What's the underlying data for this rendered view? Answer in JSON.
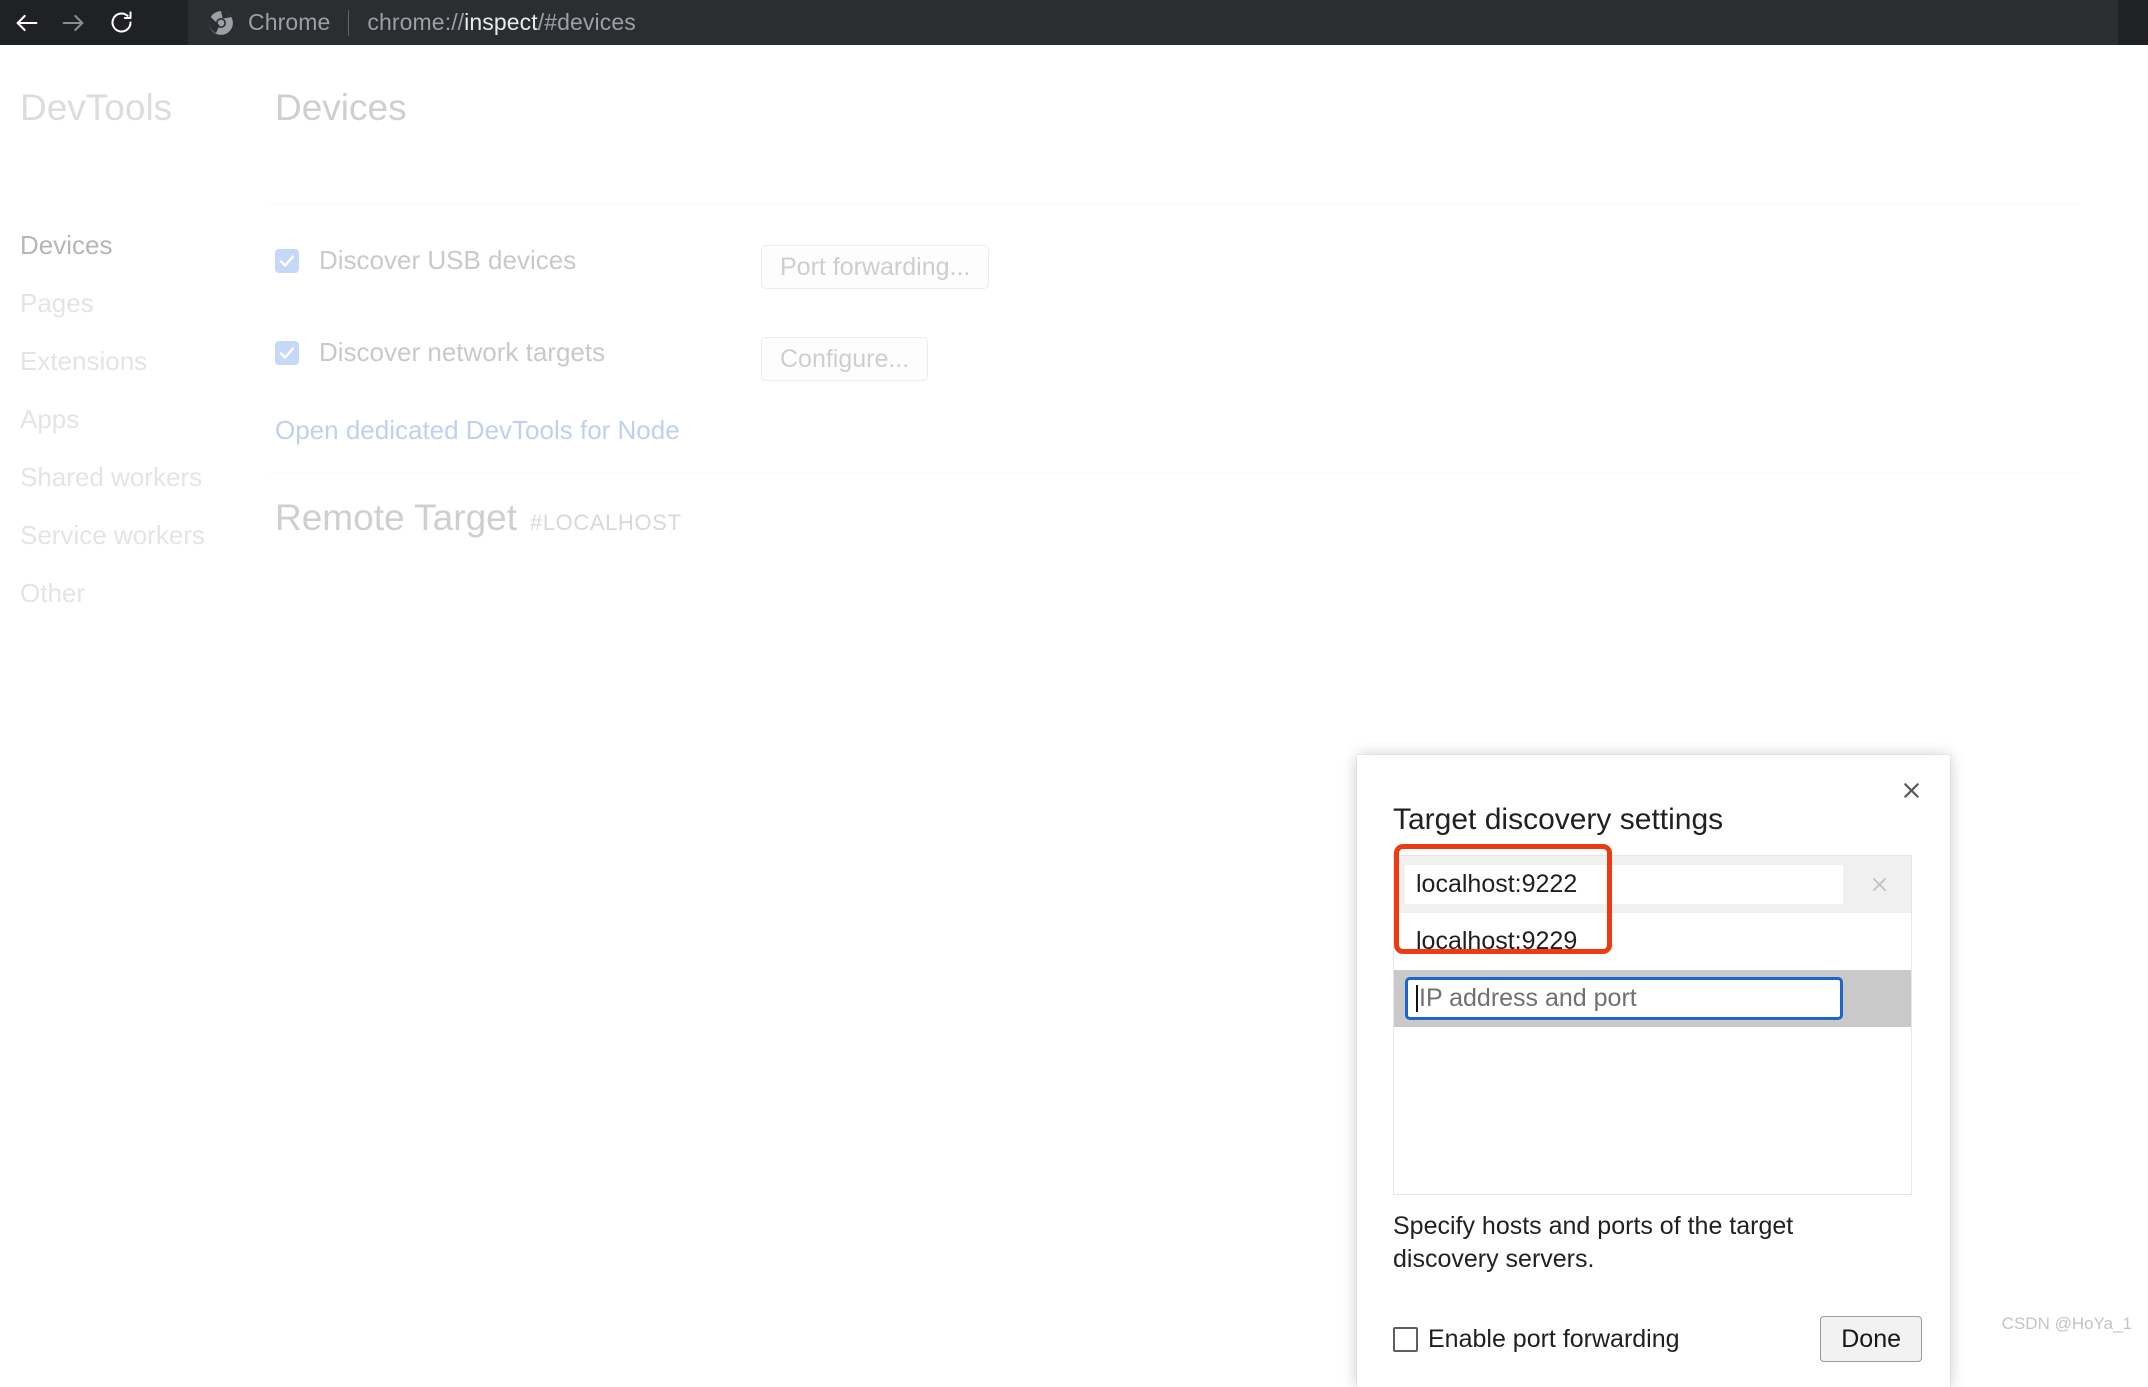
{
  "toolbar": {
    "back_icon": "arrow-left-icon",
    "forward_icon": "arrow-right-icon",
    "reload_icon": "reload-icon",
    "chrome_logo": "chrome-logo-icon",
    "brand": "Chrome",
    "url_prefix": "chrome://",
    "url_strong": "inspect",
    "url_suffix": "/#devices",
    "url_full": "chrome://inspect/#devices",
    "bg_color": "#202124",
    "omnibox_color": "#2c2d30"
  },
  "sidebar": {
    "title": "DevTools",
    "items": [
      {
        "label": "Devices",
        "active": true
      },
      {
        "label": "Pages",
        "active": false
      },
      {
        "label": "Extensions",
        "active": false
      },
      {
        "label": "Apps",
        "active": false
      },
      {
        "label": "Shared workers",
        "active": false
      },
      {
        "label": "Service workers",
        "active": false
      },
      {
        "label": "Other",
        "active": false
      }
    ]
  },
  "main": {
    "heading": "Devices",
    "checkboxes": [
      {
        "label": "Discover USB devices",
        "checked": true
      },
      {
        "label": "Discover network targets",
        "checked": true
      }
    ],
    "buttons": {
      "port_forwarding": "Port forwarding...",
      "configure": "Configure..."
    },
    "node_link": "Open dedicated DevTools for Node",
    "remote_target": {
      "title": "Remote Target",
      "host": "#LOCALHOST"
    },
    "checkbox_color": "#c5d8f7",
    "link_color": "#bfd0f0"
  },
  "dialog": {
    "title": "Target discovery settings",
    "close_icon": "close-icon",
    "rows": [
      {
        "value": "localhost:9222",
        "state": "alt",
        "remove_icon": "close-icon",
        "has_remove": true
      },
      {
        "value": "localhost:9229",
        "state": "plain",
        "remove_icon": "close-icon",
        "has_remove": false
      },
      {
        "value": "",
        "placeholder": "IP address and port",
        "state": "focused",
        "has_remove": false
      }
    ],
    "hint": "Specify hosts and ports of the target discovery servers.",
    "enable_port_forwarding": {
      "label": "Enable port forwarding",
      "checked": false
    },
    "done_label": "Done",
    "focus_border_color": "#1966cd"
  },
  "annotation": {
    "color": "#ea3b12",
    "targets": [
      "localhost:9222",
      "localhost:9229"
    ]
  },
  "watermark": "CSDN @HoYa_1"
}
